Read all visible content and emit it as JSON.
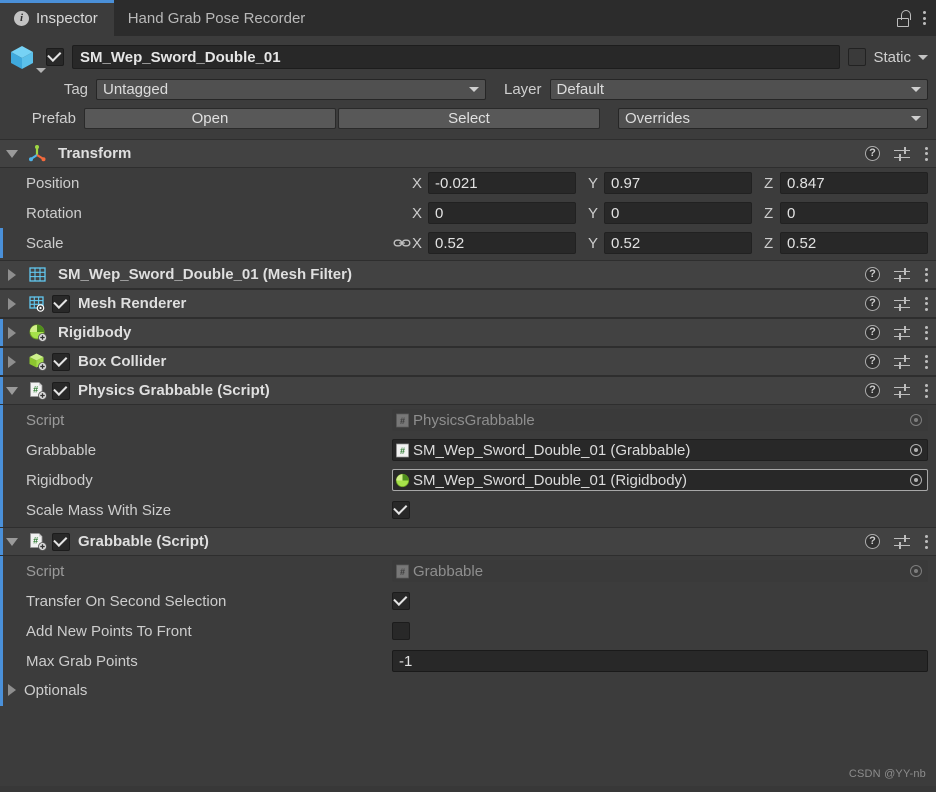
{
  "window": {
    "tabs": [
      {
        "label": "Inspector",
        "icon": "info-icon",
        "active": true
      },
      {
        "label": "Hand Grab Pose Recorder",
        "icon": "",
        "active": false
      }
    ],
    "lock_icon": "lock-open-icon",
    "menu_icon": "kebab-menu-icon",
    "accent_color": "#4a90d9",
    "background": "#383838"
  },
  "gameobject": {
    "icon": "cube-icon",
    "enabled_checkbox": true,
    "name": "SM_Wep_Sword_Double_01",
    "static_label": "Static",
    "static_checked": false,
    "tag_label": "Tag",
    "tag_value": "Untagged",
    "layer_label": "Layer",
    "layer_value": "Default",
    "prefab_label": "Prefab",
    "open_button": "Open",
    "select_button": "Select",
    "overrides_dropdown": "Overrides"
  },
  "transform": {
    "title": "Transform",
    "icon": "transform-axis-icon",
    "expanded": true,
    "rows": [
      {
        "label": "Position",
        "x": "-0.021",
        "y": "0.97",
        "z": "0.847",
        "linked": false
      },
      {
        "label": "Rotation",
        "x": "0",
        "y": "0",
        "z": "0",
        "linked": false
      },
      {
        "label": "Scale",
        "x": "0.52",
        "y": "0.52",
        "z": "0.52",
        "linked": true
      }
    ],
    "axis_labels": {
      "x": "X",
      "y": "Y",
      "z": "Z"
    },
    "help_icon": "help-icon",
    "preset_icon": "preset-settings-icon",
    "menu_icon": "kebab-menu-icon"
  },
  "components": [
    {
      "title": "SM_Wep_Sword_Double_01 (Mesh Filter)",
      "icon": "mesh-filter-icon",
      "expanded": false,
      "has_checkbox": false,
      "checked": false,
      "override": false
    },
    {
      "title": "Mesh Renderer",
      "icon": "mesh-renderer-icon",
      "expanded": false,
      "has_checkbox": true,
      "checked": true,
      "override": false
    },
    {
      "title": "Rigidbody",
      "icon": "rigidbody-icon",
      "expanded": false,
      "has_checkbox": false,
      "checked": false,
      "override": true
    },
    {
      "title": "Box Collider",
      "icon": "box-collider-icon",
      "expanded": false,
      "has_checkbox": true,
      "checked": true,
      "override": true
    }
  ],
  "physics_grabbable": {
    "title": "Physics Grabbable (Script)",
    "icon": "script-icon",
    "expanded": true,
    "checked": true,
    "override": true,
    "fields": {
      "script_label": "Script",
      "script_value": "PhysicsGrabbable",
      "grabbable_label": "Grabbable",
      "grabbable_value": "SM_Wep_Sword_Double_01 (Grabbable)",
      "rigidbody_label": "Rigidbody",
      "rigidbody_value": "SM_Wep_Sword_Double_01 (Rigidbody)",
      "scale_mass_label": "Scale Mass With Size",
      "scale_mass_checked": true
    }
  },
  "grabbable": {
    "title": "Grabbable (Script)",
    "icon": "script-icon",
    "expanded": true,
    "checked": true,
    "override": true,
    "fields": {
      "script_label": "Script",
      "script_value": "Grabbable",
      "transfer_label": "Transfer On Second Selection",
      "transfer_checked": true,
      "addnew_label": "Add New Points To Front",
      "addnew_checked": false,
      "maxgrab_label": "Max Grab Points",
      "maxgrab_value": "-1",
      "optionals_label": "Optionals",
      "optionals_expanded": false
    }
  },
  "watermark": "CSDN @YY-nb"
}
